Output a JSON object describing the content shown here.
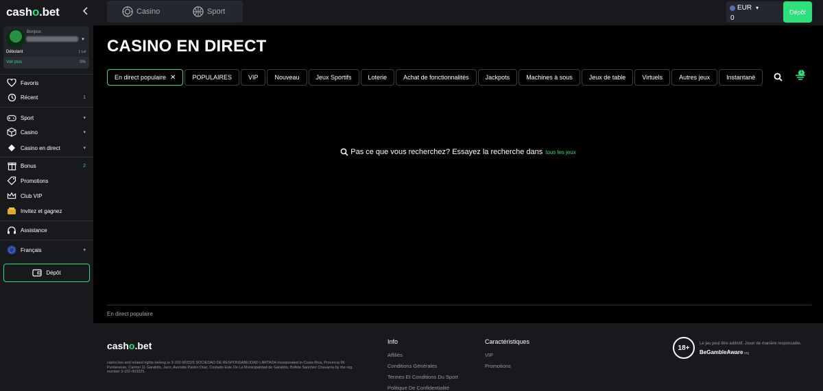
{
  "brand": {
    "logo_left": "cash",
    "logo_o": "o",
    "logo_right": ".bet"
  },
  "sidebar": {
    "collapse_icon": "chevron-left-icon",
    "profile": {
      "greeting": "Bonjour,",
      "rank": "Débutant",
      "level": "1 Lvl",
      "see_more": "Voir plus",
      "progress": "0%"
    },
    "items": [
      {
        "id": "favoris",
        "label": "Favoris",
        "icon": "heart-icon",
        "right": ""
      },
      {
        "id": "recent",
        "label": "Récent",
        "icon": "history-icon",
        "right": "1"
      },
      {
        "id": "sport",
        "label": "Sport",
        "icon": "gamepad-icon",
        "right": "▾"
      },
      {
        "id": "casino",
        "label": "Casino",
        "icon": "dice-icon",
        "right": "▾"
      },
      {
        "id": "casino-live",
        "label": "Casino en direct",
        "icon": "chip-icon",
        "right": "▾"
      },
      {
        "id": "bonus",
        "label": "Bonus",
        "icon": "gift-icon",
        "right": "2"
      },
      {
        "id": "promotions",
        "label": "Promotions",
        "icon": "tag-icon",
        "right": ""
      },
      {
        "id": "club-vip",
        "label": "Club VIP",
        "icon": "crown-icon",
        "right": ""
      },
      {
        "id": "invite",
        "label": "Invitez et gagnez",
        "icon": "money-icon",
        "right": ""
      },
      {
        "id": "assistance",
        "label": "Assistance",
        "icon": "headset-icon",
        "right": ""
      },
      {
        "id": "language",
        "label": "Français",
        "icon": "eu-flag-icon",
        "right": "▾"
      }
    ],
    "deposit_label": "Dépôt"
  },
  "topbar": {
    "casino_label": "Casino",
    "sport_label": "Sport",
    "currency": "EUR",
    "balance": "0",
    "deposit_label": "Dépôt"
  },
  "main": {
    "title": "CASINO EN DIRECT",
    "chips": [
      "En direct populaire",
      "POPULAIRES",
      "VIP",
      "Nouveau",
      "Jeux Sportifs",
      "Loterie",
      "Achat de fonctionnalités",
      "Jackpots",
      "Machines à sous",
      "Jeux de table",
      "Virtuels",
      "Autres jeux",
      "Instantané"
    ],
    "filter_count": "1",
    "empty_text": "Pas ce que vous recherchez? Essayez la recherche dans",
    "empty_link": "tous les jeux",
    "section_label": "En direct populaire"
  },
  "footer": {
    "copyright": "casho.bet and related rights belong to 3-102-903325 SOCIEDAD DE RESPONSABILIDAD LIMITADA incorporated in Costa Rica, Provincia 06 Puntarenas, Canton 11 Garabito, Jaco, Avenida Pastor Díaz, Costado Este De La Municipalidad de Garabito, Bufete Sanchez Chavarria by the reg. number 3-102-903325.",
    "info_head": "Info",
    "info_links": [
      "Affiliés",
      "Conditions Générales",
      "Termes Et Conditions Du Sport",
      "Politique De Confidentialité"
    ],
    "features_head": "Caractéristiques",
    "features_links": [
      "VIP",
      "Promotions"
    ],
    "age": "18+",
    "responsible": "Le jeu peut être addictif. Jouer de manière responsable.",
    "begamble": "BeGambleAware",
    "begamble_org": ".org"
  },
  "colors": {
    "accent": "#2ee07a",
    "sidebar": "#17191d",
    "background": "#000000"
  }
}
